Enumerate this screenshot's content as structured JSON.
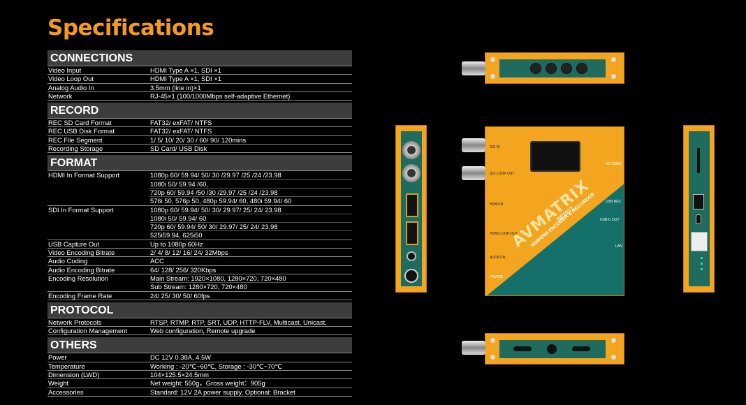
{
  "title": "Specifications",
  "sections": [
    {
      "heading": "CONNECTIONS",
      "rows": [
        {
          "label": "Video Input",
          "values": [
            "HDMI Type A ×1, SDI ×1"
          ]
        },
        {
          "label": "Video Loop Out",
          "values": [
            "HDMI Type A ×1, SDI ×1"
          ]
        },
        {
          "label": "Analog Audio In",
          "values": [
            "3.5mm (line in)×1"
          ]
        },
        {
          "label": "Network",
          "values": [
            "RJ-45×1 (100/1000Mbps self-adaptive Ethernet)"
          ]
        }
      ]
    },
    {
      "heading": "RECORD",
      "rows": [
        {
          "label": "REC SD Card Format",
          "values": [
            "FAT32/ exFAT/ NTFS"
          ]
        },
        {
          "label": "REC USB Disk Format",
          "values": [
            "FAT32/ exFAT/ NTFS"
          ]
        },
        {
          "label": "REC File Segment",
          "values": [
            "1/ 5/ 10/ 20/ 30 / 60/ 90/ 120mins"
          ]
        },
        {
          "label": "Recording Storage",
          "values": [
            "SD Card/ USB Disk"
          ]
        }
      ]
    },
    {
      "heading": "FORMAT",
      "rows": [
        {
          "label": "HDMI In Format Support",
          "values": [
            "1080p 60/ 59.94/ 50/ 30 /29.97 /25 /24 /23.98",
            "1080i 50/ 59.94 /60,",
            "720p 60/ 59.94 /50 /30 /29.97 /25 /24 /23.98",
            "576i 50, 576p 50, 480p 59.94/ 60, 480i 59.94/ 60"
          ]
        },
        {
          "label": "SDI In Format Support",
          "values": [
            "1080p 60/ 59.94/ 50/ 30/ 29.97/ 25/ 24/ 23.98",
            "1080i 50/ 59.94/ 60",
            "720p 60/ 59.94/ 50/ 30/ 29.97/ 25/ 24/ 23.98",
            "525i59.94, 625i50"
          ]
        },
        {
          "label": "USB Capture Out",
          "values": [
            "Up to 1080p 60Hz"
          ]
        },
        {
          "label": "Video Encoding Bitrate",
          "values": [
            "2/ 4/ 8/ 12/ 16/ 24/ 32Mbps"
          ]
        },
        {
          "label": "Audio Coding",
          "values": [
            "ACC"
          ]
        },
        {
          "label": "Audio Encoding Bitrate",
          "values": [
            "64/ 128/ 256/ 320Kbps"
          ]
        },
        {
          "label": "Encoding Resolution",
          "values": [
            "Main Stream: 1920×1080, 1280×720, 720×480",
            "Sub Stream: 1280×720, 720×480"
          ]
        },
        {
          "label": "Encoding Frame Rate",
          "values": [
            "24/ 25/ 30/ 50/ 60fps"
          ]
        }
      ]
    },
    {
      "heading": "PROTOCOL",
      "rows": [
        {
          "label": "Network Protocols",
          "values": [
            "RTSP, RTMP, RTP, SRT, UDP, HTTP-FLV, Multicast, Unicast,"
          ]
        },
        {
          "label": "Configuration Management",
          "values": [
            "Web configuration, Remote upgrade"
          ]
        }
      ]
    },
    {
      "heading": "OTHERS",
      "rows": [
        {
          "label": "Power",
          "values": [
            "DC 12V 0.38A, 4.5W"
          ]
        },
        {
          "label": "Temperature",
          "values": [
            "Working : -20℃~60℃, Storage : -30℃~70℃"
          ]
        },
        {
          "label": "Dimension (LWD)",
          "values": [
            "104×125.5×24.5mm"
          ]
        },
        {
          "label": "Weight",
          "values": [
            "Net weight: 550g，Gross weight：905g"
          ]
        },
        {
          "label": "Accessories",
          "values": [
            "Standard: 12V 2A power supply, Optional: Bracket"
          ]
        }
      ]
    }
  ],
  "device": {
    "brand": "AVMATRIX",
    "product_line": "SDI/HDMI ENCODER & RECORDER",
    "model": "SE2017",
    "port_labels": {
      "sdi_in": "SDI IN",
      "sdi_loop_out": "SDI LOOP OUT",
      "hdmi_in": "HDMI IN",
      "hdmi_loop_out": "HDMI LOOP OUT",
      "audio_in": "AUDIO IN",
      "power": "POWER",
      "sd_card": "SD CARD",
      "usb_rec": "USB REC",
      "usb_c_out": "USB-C OUT",
      "lan": "LAN"
    },
    "colors": {
      "body": "#f3a51f",
      "panel": "#16706a",
      "title": "#f39a1f"
    }
  }
}
